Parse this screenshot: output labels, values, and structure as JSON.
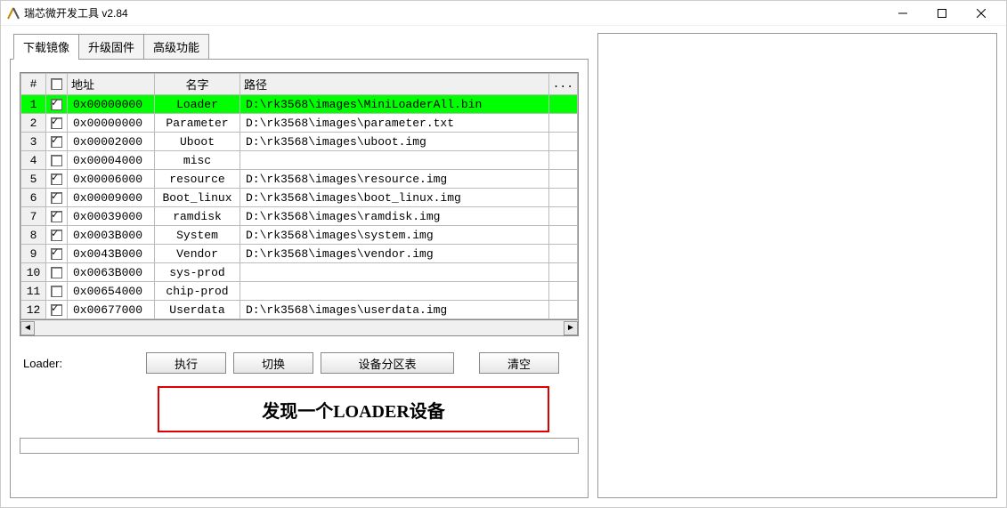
{
  "window": {
    "title": "瑞芯微开发工具 v2.84"
  },
  "tabs": [
    {
      "label": "下载镜像",
      "active": true
    },
    {
      "label": "升级固件",
      "active": false
    },
    {
      "label": "高级功能",
      "active": false
    }
  ],
  "table": {
    "headers": {
      "index": "#",
      "chk": "□",
      "addr": "地址",
      "name": "名字",
      "path": "路径",
      "dots": "..."
    },
    "rows": [
      {
        "num": "1",
        "checked": true,
        "addr": "0x00000000",
        "name": "Loader",
        "path": "D:\\rk3568\\images\\MiniLoaderAll.bin",
        "highlight": true
      },
      {
        "num": "2",
        "checked": true,
        "addr": "0x00000000",
        "name": "Parameter",
        "path": "D:\\rk3568\\images\\parameter.txt",
        "highlight": false
      },
      {
        "num": "3",
        "checked": true,
        "addr": "0x00002000",
        "name": "Uboot",
        "path": "D:\\rk3568\\images\\uboot.img",
        "highlight": false
      },
      {
        "num": "4",
        "checked": false,
        "addr": "0x00004000",
        "name": "misc",
        "path": "",
        "highlight": false
      },
      {
        "num": "5",
        "checked": true,
        "addr": "0x00006000",
        "name": "resource",
        "path": "D:\\rk3568\\images\\resource.img",
        "highlight": false
      },
      {
        "num": "6",
        "checked": true,
        "addr": "0x00009000",
        "name": "Boot_linux",
        "path": "D:\\rk3568\\images\\boot_linux.img",
        "highlight": false
      },
      {
        "num": "7",
        "checked": true,
        "addr": "0x00039000",
        "name": "ramdisk",
        "path": "D:\\rk3568\\images\\ramdisk.img",
        "highlight": false
      },
      {
        "num": "8",
        "checked": true,
        "addr": "0x0003B000",
        "name": "System",
        "path": "D:\\rk3568\\images\\system.img",
        "highlight": false
      },
      {
        "num": "9",
        "checked": true,
        "addr": "0x0043B000",
        "name": "Vendor",
        "path": "D:\\rk3568\\images\\vendor.img",
        "highlight": false
      },
      {
        "num": "10",
        "checked": false,
        "addr": "0x0063B000",
        "name": "sys-prod",
        "path": "",
        "highlight": false
      },
      {
        "num": "11",
        "checked": false,
        "addr": "0x00654000",
        "name": "chip-prod",
        "path": "",
        "highlight": false
      },
      {
        "num": "12",
        "checked": true,
        "addr": "0x00677000",
        "name": "Userdata",
        "path": "D:\\rk3568\\images\\userdata.img",
        "highlight": false
      }
    ]
  },
  "loader_label": "Loader:",
  "buttons": {
    "run": "执行",
    "switch": "切换",
    "partition": "设备分区表",
    "clear": "清空"
  },
  "status_text": "发现一个LOADER设备"
}
